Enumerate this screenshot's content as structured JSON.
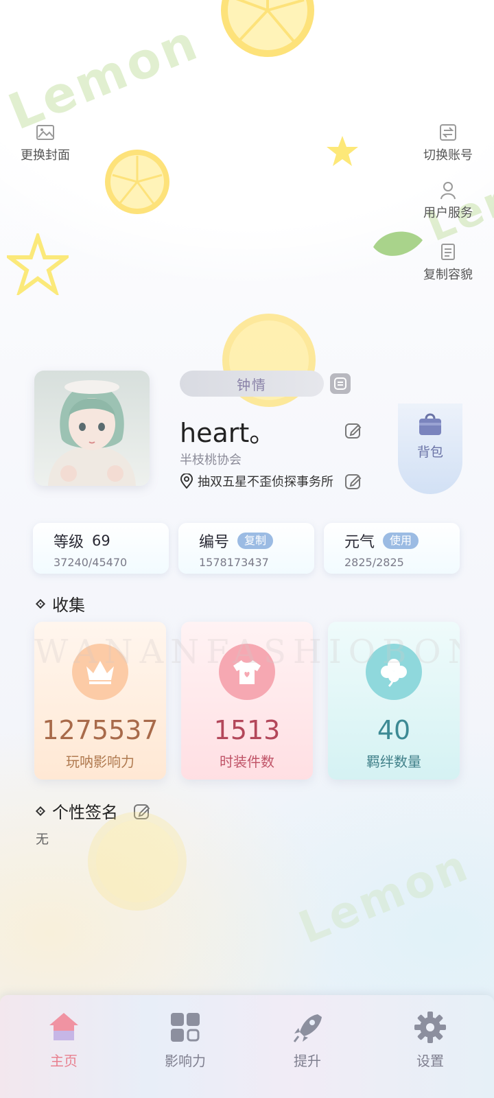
{
  "top_actions": {
    "change_cover": "更换封面",
    "switch_account": "切换账号",
    "user_service": "用户服务",
    "copy_appearance": "复制容貌"
  },
  "profile": {
    "title_badge": "钟情",
    "username": "heart。",
    "guild": "半枝桃协会",
    "location": "抽双五星不歪侦探事务所",
    "bag_label": "背包"
  },
  "stats": {
    "level": {
      "label": "等级",
      "value": "69",
      "progress": "37240/45470"
    },
    "id": {
      "label": "编号",
      "button": "复制",
      "value": "1578173437"
    },
    "energy": {
      "label": "元气",
      "button": "使用",
      "value": "2825/2825"
    }
  },
  "collection": {
    "title": "收集",
    "cards": [
      {
        "value": "1275537",
        "label": "玩呐影响力",
        "icon": "crown-icon",
        "color": "#a86a4a"
      },
      {
        "value": "1513",
        "label": "时装件数",
        "icon": "tshirt-icon",
        "color": "#b3475a"
      },
      {
        "value": "40",
        "label": "羁绊数量",
        "icon": "clover-icon",
        "color": "#3d8a94"
      }
    ],
    "watermark": "WANANFASHIOBOND"
  },
  "signature": {
    "title": "个性签名",
    "value": "无"
  },
  "bottom_nav": {
    "items": [
      {
        "label": "主页",
        "icon": "home-icon",
        "active": true
      },
      {
        "label": "影响力",
        "icon": "grid-icon",
        "active": false
      },
      {
        "label": "提升",
        "icon": "rocket-icon",
        "active": false
      },
      {
        "label": "设置",
        "icon": "gear-icon",
        "active": false
      }
    ]
  },
  "colors": {
    "active_nav": "#e8808f",
    "inactive_nav": "#7f7f8f",
    "pill_button": "#9bbbe3"
  }
}
